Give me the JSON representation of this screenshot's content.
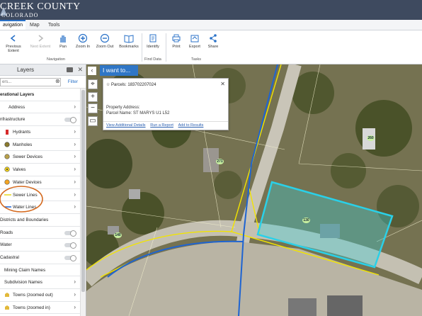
{
  "header": {
    "title_line1": "CREEK COUNTY",
    "title_line2": "COLORADO"
  },
  "tabs": [
    {
      "label": "avigation",
      "active": true
    },
    {
      "label": "Map",
      "active": false
    },
    {
      "label": "Tools",
      "active": false
    }
  ],
  "ribbon": {
    "buttons": [
      {
        "label": "Previous Extent",
        "icon": "arrow-left-icon",
        "enabled": true
      },
      {
        "label": "Next Extent",
        "icon": "arrow-right-icon",
        "enabled": false
      },
      {
        "label": "Pan",
        "icon": "hand-icon",
        "enabled": true
      },
      {
        "label": "Zoom In",
        "icon": "zoom-in-icon",
        "enabled": true
      },
      {
        "label": "Zoom Out",
        "icon": "zoom-out-icon",
        "enabled": true
      },
      {
        "label": "Bookmarks",
        "icon": "book-icon",
        "enabled": true
      },
      {
        "label": "Identify",
        "icon": "identify-icon",
        "enabled": true
      },
      {
        "label": "Print",
        "icon": "printer-icon",
        "enabled": true
      },
      {
        "label": "Export",
        "icon": "export-icon",
        "enabled": true
      },
      {
        "label": "Share",
        "icon": "share-icon",
        "enabled": true
      }
    ],
    "groups": {
      "navigation": "Navigation",
      "find_data": "Find Data",
      "tasks": "Tasks"
    }
  },
  "layers": {
    "title": "Layers",
    "filter_placeholder": "ers...",
    "filter_button": "Filter",
    "rows": [
      {
        "label": "erational Layers",
        "indent": 0,
        "bold": true,
        "control": "none"
      },
      {
        "label": "Address",
        "indent": 12,
        "control": "chevron"
      },
      {
        "label": "nfrastructure",
        "indent": 0,
        "control": "switch"
      },
      {
        "label": "Hydrants",
        "indent": 18,
        "icon": "hydrant-icon",
        "control": "chevron"
      },
      {
        "label": "Manholes",
        "indent": 18,
        "icon": "manhole-icon",
        "control": "chevron"
      },
      {
        "label": "Sewer Devices",
        "indent": 18,
        "icon": "sewer-device-icon",
        "control": "chevron"
      },
      {
        "label": "Valves",
        "indent": 18,
        "icon": "valve-icon",
        "control": "chevron"
      },
      {
        "label": "Water Devices",
        "indent": 18,
        "icon": "water-device-icon",
        "control": "chevron"
      },
      {
        "label": "Sewer Lines",
        "indent": 18,
        "icon": "sewer-line-icon",
        "control": "chevron"
      },
      {
        "label": "Water Lines",
        "indent": 18,
        "icon": "water-line-icon",
        "control": "chevron"
      },
      {
        "label": "Districts and Boundaries",
        "indent": 0,
        "control": "none"
      },
      {
        "label": "Roads",
        "indent": 0,
        "control": "switch"
      },
      {
        "label": "Water",
        "indent": 0,
        "control": "switch"
      },
      {
        "label": "Cadastral",
        "indent": 0,
        "control": "switch"
      },
      {
        "label": "Mining Claim Names",
        "indent": 6,
        "control": "none"
      },
      {
        "label": "Subdivision Names",
        "indent": 6,
        "control": "chevron"
      },
      {
        "label": "Towns (zoomed out)",
        "indent": 18,
        "icon": "town-icon",
        "control": "chevron"
      },
      {
        "label": "Towns (zoomed in)",
        "indent": 18,
        "icon": "town-icon",
        "control": "chevron"
      }
    ]
  },
  "map": {
    "i_want_to": "I want to...",
    "popup": {
      "title": "Parcels: 183702207024",
      "address": "Property Address:",
      "parcel_name": "Parcel Name: ST MARYS U1 L52",
      "links": [
        "View Additional Details",
        "Run a Report",
        "Add to Results"
      ]
    },
    "labels": [
      "271",
      "260",
      "130",
      "140"
    ]
  }
}
